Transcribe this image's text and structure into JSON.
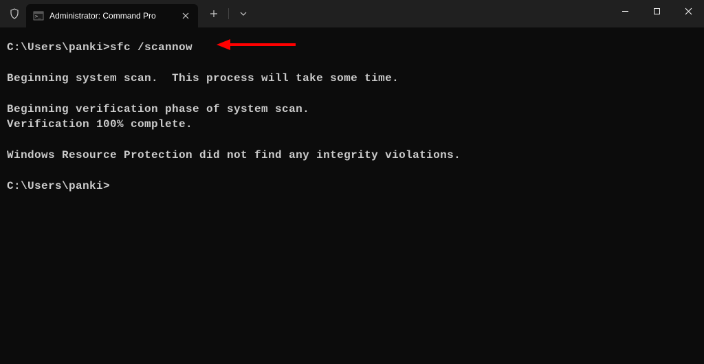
{
  "window": {
    "tab_title": "Administrator: Command Pro"
  },
  "terminal": {
    "line1_prompt": "C:\\Users\\panki>",
    "line1_command": "sfc /scannow",
    "line2": "",
    "line3": "Beginning system scan.  This process will take some time.",
    "line4": "",
    "line5": "Beginning verification phase of system scan.",
    "line6": "Verification 100% complete.",
    "line7": "",
    "line8": "Windows Resource Protection did not find any integrity violations.",
    "line9": "",
    "line10_prompt": "C:\\Users\\panki>"
  },
  "annotation": {
    "arrow_color": "#ff0000"
  }
}
